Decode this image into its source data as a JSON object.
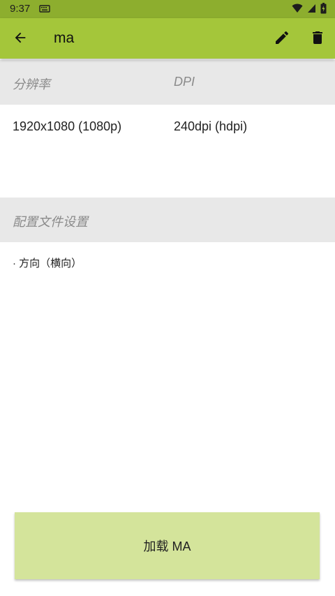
{
  "status_bar": {
    "time": "9:37",
    "notification_icon": "keyboard-icon",
    "icons": [
      "wifi-icon",
      "signal-icon",
      "battery-icon"
    ]
  },
  "app_bar": {
    "title": "ma",
    "back_icon": "arrow-back-icon",
    "edit_icon": "pencil-icon",
    "delete_icon": "trash-icon"
  },
  "display": {
    "header_resolution": "分辨率",
    "header_dpi": "DPI",
    "resolution_value": "1920x1080 (1080p)",
    "dpi_value": "240dpi (hdpi)"
  },
  "profile_settings": {
    "header": "配置文件设置",
    "items": [
      "· 方向（横向）"
    ]
  },
  "load_button": {
    "label": "加载 MA"
  },
  "colors": {
    "status_bar": "#8dae2e",
    "app_bar": "#a4c63a",
    "header_bg": "#e8e8e8",
    "button_bg": "#d4e49b"
  }
}
